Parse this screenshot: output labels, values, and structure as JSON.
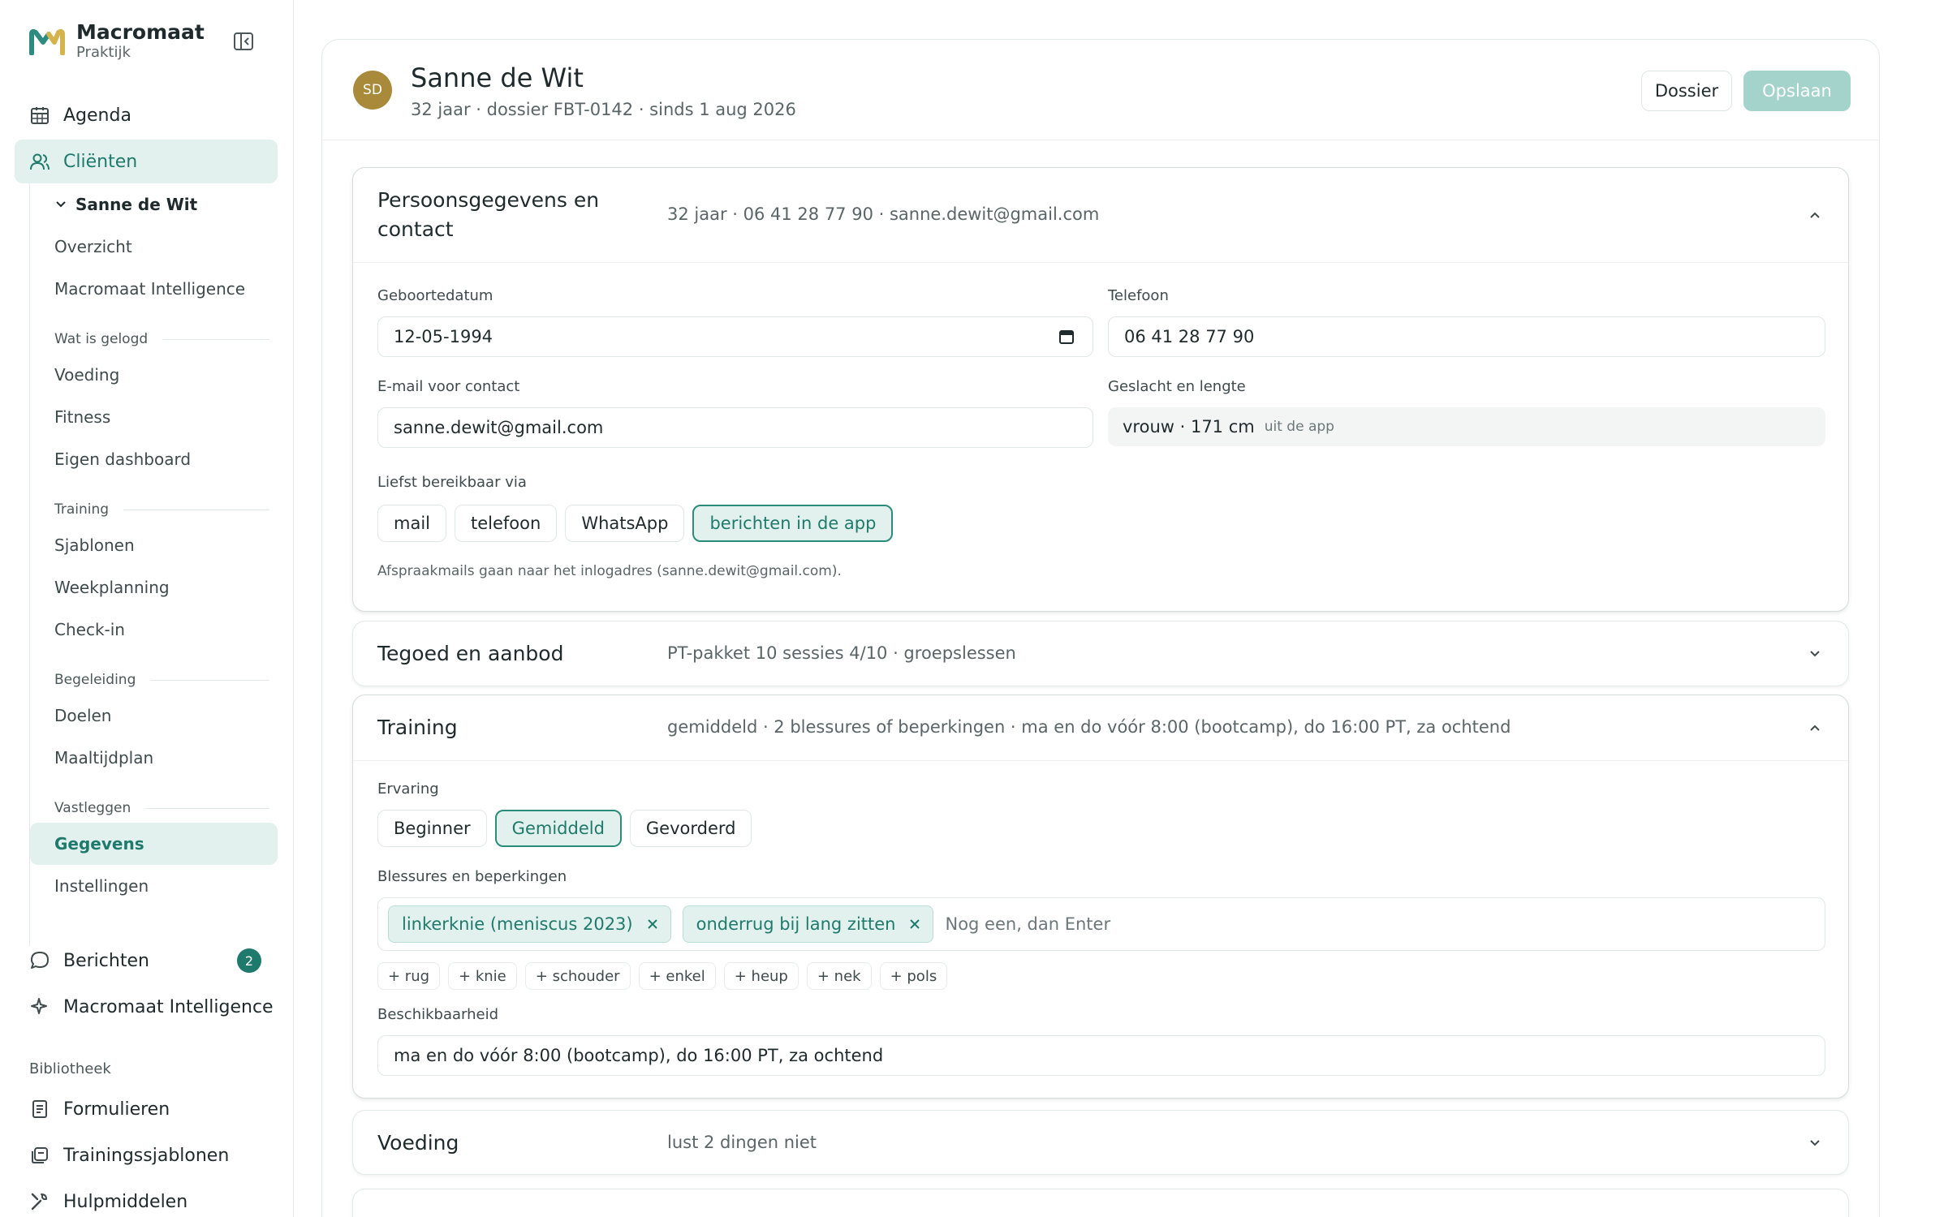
{
  "brand": {
    "name": "Macromaat",
    "subtitle": "Praktijk"
  },
  "sidebar": {
    "nav_top": [
      {
        "label": "Agenda",
        "icon": "calendar-icon"
      },
      {
        "label": "Cliënten",
        "icon": "users-icon",
        "active": true
      }
    ],
    "client": "Sanne de Wit",
    "client_items": [
      "Overzicht",
      "Macromaat Intelligence"
    ],
    "groups": [
      {
        "title": "Wat is gelogd",
        "items": [
          "Voeding",
          "Fitness",
          "Eigen dashboard"
        ]
      },
      {
        "title": "Training",
        "items": [
          "Sjablonen",
          "Weekplanning",
          "Check-in"
        ]
      },
      {
        "title": "Begeleiding",
        "items": [
          "Doelen",
          "Maaltijdplan"
        ]
      },
      {
        "title": "Vastleggen",
        "items": [
          "Gegevens",
          "Instellingen"
        ]
      }
    ],
    "messages": {
      "label": "Berichten",
      "count": "2"
    },
    "intelligence": {
      "label": "Macromaat Intelligence"
    },
    "library_title": "Bibliotheek",
    "library": [
      "Formulieren",
      "Trainingssjablonen",
      "Hulpmiddelen"
    ]
  },
  "client_header": {
    "initials": "SD",
    "name": "Sanne de Wit",
    "meta": "32 jaar · dossier FBT-0142 · sinds 1 aug 2026",
    "dossier_label": "Dossier",
    "save_label": "Opslaan"
  },
  "sections": {
    "personal": {
      "title": "Persoonsgegevens en contact",
      "summary": "32 jaar · 06 41 28 77 90 · sanne.dewit@gmail.com",
      "birthdate_label": "Geboortedatum",
      "birthdate_value": "12-05-1994",
      "phone_label": "Telefoon",
      "phone_value": "06 41 28 77 90",
      "email_label": "E-mail voor contact",
      "email_value": "sanne.dewit@gmail.com",
      "sex_height_label": "Geslacht en lengte",
      "sex_height_value": "vrouw · 171 cm",
      "sex_height_hint": "uit de app",
      "reach_label": "Liefst bereikbaar via",
      "reach_options": [
        "mail",
        "telefoon",
        "WhatsApp",
        "berichten in de app"
      ],
      "reach_selected": "berichten in de app",
      "note": "Afspraakmails gaan naar het inlogadres (sanne.dewit@gmail.com)."
    },
    "credit": {
      "title": "Tegoed en aanbod",
      "summary": "PT-pakket 10 sessies 4/10 · groepslessen"
    },
    "training": {
      "title": "Training",
      "summary": "gemiddeld · 2 blessures of beperkingen · ma en do vóór 8:00 (bootcamp), do 16:00 PT, za ochtend",
      "experience_label": "Ervaring",
      "experience_options": [
        "Beginner",
        "Gemiddeld",
        "Gevorderd"
      ],
      "experience_selected": "Gemiddeld",
      "injuries_label": "Blessures en beperkingen",
      "injuries": [
        "linkerknie (meniscus 2023)",
        "onderrug bij lang zitten"
      ],
      "injuries_placeholder": "Nog een, dan Enter",
      "suggestions": [
        "+ rug",
        "+ knie",
        "+ schouder",
        "+ enkel",
        "+ heup",
        "+ nek",
        "+ pols"
      ],
      "availability_label": "Beschikbaarheid",
      "availability_value": "ma en do vóór 8:00 (bootcamp), do 16:00 PT, za ochtend"
    },
    "nutrition": {
      "title": "Voeding",
      "summary": "lust 2 dingen niet"
    }
  },
  "colors": {
    "accent": "#1e7a6c",
    "accent_bg": "#e3f1ee",
    "save_disabled": "#a4d3cb",
    "avatar": "#a88a3a"
  }
}
